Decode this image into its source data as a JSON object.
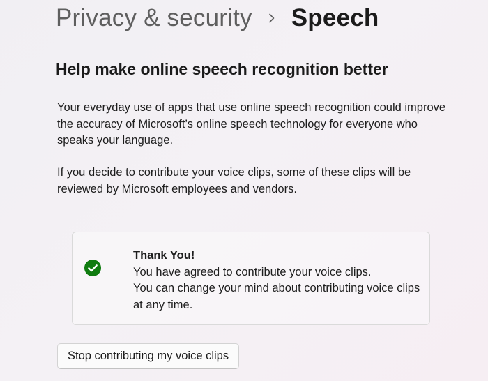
{
  "breadcrumb": {
    "parent": "Privacy & security",
    "separator_icon": "chevron-right-icon",
    "current": "Speech"
  },
  "section": {
    "title": "Help make online speech recognition better",
    "paragraphs": [
      "Your everyday use of apps that use online speech recognition could improve the accuracy of Microsoft’s online speech technology for everyone who speaks your language.",
      "If you decide to contribute your voice clips, some of these clips will be reviewed by Microsoft employees and vendors."
    ]
  },
  "status_card": {
    "icon": "check-circle-icon",
    "icon_color": "#107c10",
    "title": "Thank You!",
    "line1": "You have agreed to contribute your voice clips.",
    "line2": "You can change your mind about contributing voice clips at any time."
  },
  "actions": {
    "stop_button_label": "Stop contributing my voice clips"
  }
}
